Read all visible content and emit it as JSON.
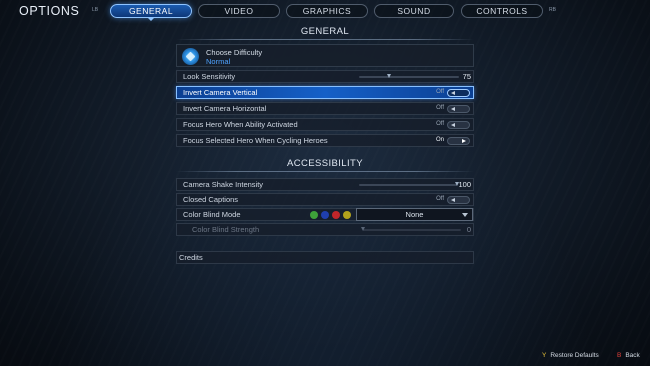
{
  "header": {
    "title": "OPTIONS",
    "left_bumper": "LB",
    "right_bumper": "RB",
    "tabs": [
      {
        "label": "GENERAL",
        "active": true
      },
      {
        "label": "VIDEO",
        "active": false
      },
      {
        "label": "GRAPHICS",
        "active": false
      },
      {
        "label": "SOUND",
        "active": false
      },
      {
        "label": "CONTROLS",
        "active": false
      }
    ]
  },
  "general": {
    "heading": "GENERAL",
    "difficulty": {
      "title": "Choose Difficulty",
      "value": "Normal"
    },
    "look_sensitivity": {
      "label": "Look Sensitivity",
      "value": "75",
      "fraction": 0.3
    },
    "invert_vertical": {
      "label": "Invert Camera Vertical",
      "state": "Off"
    },
    "invert_horizontal": {
      "label": "Invert Camera Horizontal",
      "state": "Off"
    },
    "focus_hero": {
      "label": "Focus Hero When Ability Activated",
      "state": "Off"
    },
    "focus_selected": {
      "label": "Focus Selected Hero When Cycling Heroes",
      "state": "On"
    }
  },
  "accessibility": {
    "heading": "ACCESSIBILITY",
    "camera_shake": {
      "label": "Camera Shake Intensity",
      "value": "100",
      "fraction": 1.0
    },
    "closed_captions": {
      "label": "Closed Captions",
      "state": "Off"
    },
    "color_blind_mode": {
      "label": "Color Blind Mode",
      "value": "None",
      "swatches": [
        "#3ea33a",
        "#1f3fb0",
        "#c1262a",
        "#b3a31c"
      ]
    },
    "color_blind_strength": {
      "label": "Color Blind Strength",
      "value": "0",
      "fraction": 0.0
    }
  },
  "credits": {
    "label": "Credits"
  },
  "footer": {
    "restore": {
      "glyph": "Y",
      "label": "Restore Defaults",
      "color": "#e8c33a"
    },
    "back": {
      "glyph": "B",
      "label": "Back",
      "color": "#e2403a"
    }
  },
  "theme": {
    "accent": "#1560c8",
    "highlight": "#88c0ff",
    "difficulty_text": "#4fa3ff"
  }
}
